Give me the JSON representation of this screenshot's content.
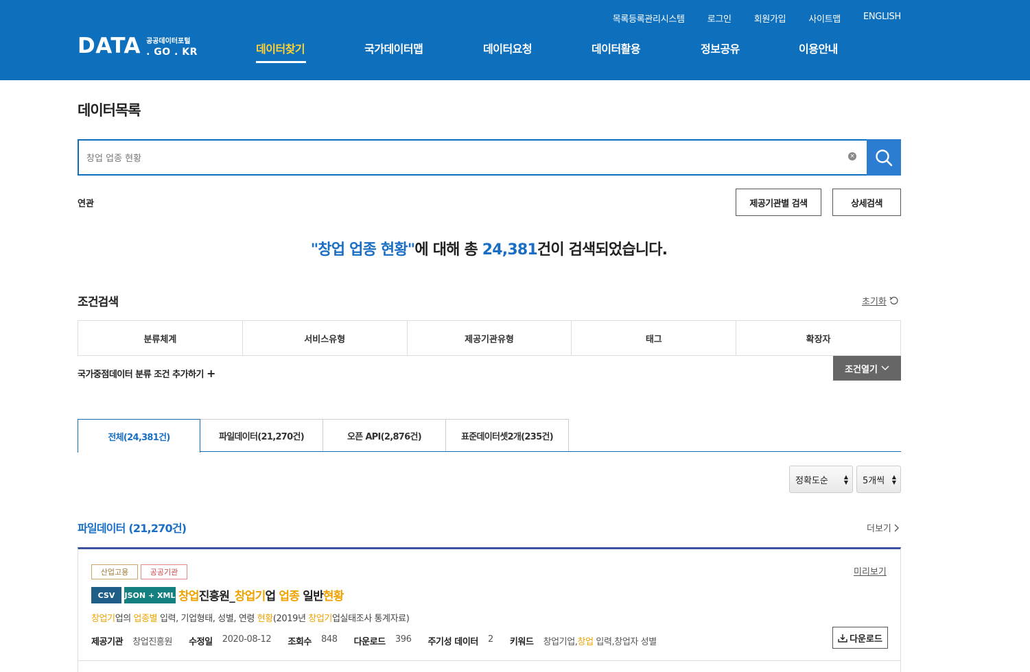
{
  "header": {
    "util_links": [
      "목록등록관리시스템",
      "로그인",
      "회원가입",
      "사이트맵",
      "ENGLISH"
    ],
    "logo": {
      "main": "DATA",
      "ko": "공공데이터포털",
      "en": ". GO . KR"
    },
    "nav": [
      {
        "label": "데이터찾기",
        "active": true
      },
      {
        "label": "국가데이터맵",
        "active": false
      },
      {
        "label": "데이터요청",
        "active": false
      },
      {
        "label": "데이터활용",
        "active": false
      },
      {
        "label": "정보공유",
        "active": false
      },
      {
        "label": "이용안내",
        "active": false
      }
    ],
    "bg_color": "#0e6fbd",
    "active_color": "#ffd234"
  },
  "page_title": "데이터목록",
  "search": {
    "value": "창업 업종 현황",
    "placeholder": "창업 업종 현황"
  },
  "related_label": "연관",
  "buttons": {
    "org_search": "제공기관별 검색",
    "detail_search": "상세검색"
  },
  "result": {
    "query_quoted": "\"창업 업종 현황\"",
    "mid": "에 대해 총 ",
    "count": "24,381",
    "tail": "건이 검색되었습니다."
  },
  "conditions": {
    "title": "조건검색",
    "reset": "초기화",
    "columns": [
      "분류체계",
      "서비스유형",
      "제공기관유형",
      "태그",
      "확장자"
    ],
    "add_label": "국가중점데이터 분류 조건 추가하기",
    "open_label": "조건열기"
  },
  "tabs": [
    "전체(24,381건)",
    "파일데이터(21,270건)",
    "오픈 API(2,876건)",
    "표준데이터셋2개(235건)"
  ],
  "sort": {
    "order": "정확도순",
    "per_page": "5개씩"
  },
  "section": {
    "title": "파일데이터 (21,270건)",
    "more": "더보기"
  },
  "item": {
    "badges": [
      "산업고용",
      "공공기관"
    ],
    "preview": "미리보기",
    "formats": [
      "CSV",
      "JSON + XML"
    ],
    "title_parts": [
      {
        "t": "창업",
        "hl": true
      },
      {
        "t": "진흥원_",
        "hl": false
      },
      {
        "t": "창업기",
        "hl": true
      },
      {
        "t": "업 ",
        "hl": false
      },
      {
        "t": "업종",
        "hl": true
      },
      {
        "t": " 일반",
        "hl": false
      },
      {
        "t": "현황",
        "hl": true
      }
    ],
    "desc_parts": [
      {
        "t": "창업기",
        "hl": true
      },
      {
        "t": "업의 ",
        "hl": false
      },
      {
        "t": "업종별",
        "hl": true
      },
      {
        "t": " 입력, 기업형태, 성별, 연령 ",
        "hl": false
      },
      {
        "t": "현황",
        "hl": true
      },
      {
        "t": "(2019년 ",
        "hl": false
      },
      {
        "t": "창업기",
        "hl": true
      },
      {
        "t": "업실태조사 통계자료)",
        "hl": false
      }
    ],
    "meta": [
      {
        "k": "제공기관",
        "v": "창업진흥원"
      },
      {
        "k": "수정일",
        "v": "2020-08-12"
      },
      {
        "k": "조회수",
        "v": "848"
      },
      {
        "k": "다운로드",
        "v": "396"
      },
      {
        "k": "주기성 데이터",
        "v": "2"
      }
    ],
    "keywords_label": "키워드",
    "keywords_parts": [
      {
        "t": "창업기업,",
        "hl": false
      },
      {
        "t": "창업",
        "hl": true
      },
      {
        "t": " 입력,창업자 성별",
        "hl": false
      }
    ],
    "download": "다운로드"
  }
}
